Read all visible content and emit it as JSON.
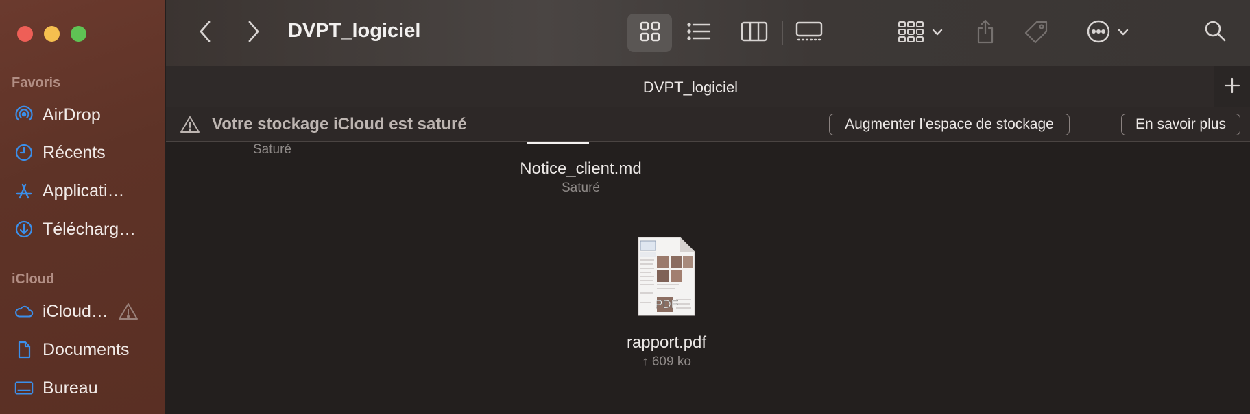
{
  "window": {
    "title": "DVPT_logiciel",
    "tab_title": "DVPT_logiciel"
  },
  "sidebar": {
    "favorites_title": "Favoris",
    "icloud_title": "iCloud",
    "favorites": [
      {
        "label": "AirDrop",
        "icon": "airdrop-icon"
      },
      {
        "label": "Récents",
        "icon": "clock-icon"
      },
      {
        "label": "Applicati…",
        "icon": "applications-icon"
      },
      {
        "label": "Télécharg…",
        "icon": "download-icon"
      }
    ],
    "icloud": [
      {
        "label": "iCloud…",
        "icon": "cloud-icon"
      },
      {
        "label": "Documents",
        "icon": "document-icon"
      },
      {
        "label": "Bureau",
        "icon": "desktop-icon"
      }
    ]
  },
  "banner": {
    "message": "Votre stockage iCloud est saturé",
    "upgrade_label": "Augmenter l’espace de stockage",
    "learn_label": "En savoir plus"
  },
  "files": [
    {
      "name": "",
      "status": "Saturé"
    },
    {
      "name": "Notice_client.md",
      "status": "Saturé"
    },
    {
      "name": "rapport.pdf",
      "status": "↑ 609 ko",
      "icon_text": "PDF"
    }
  ],
  "colors": {
    "accent_blue": "#3b8fea",
    "sidebar_bg": "#5e3327",
    "content_bg": "#231f1e"
  }
}
